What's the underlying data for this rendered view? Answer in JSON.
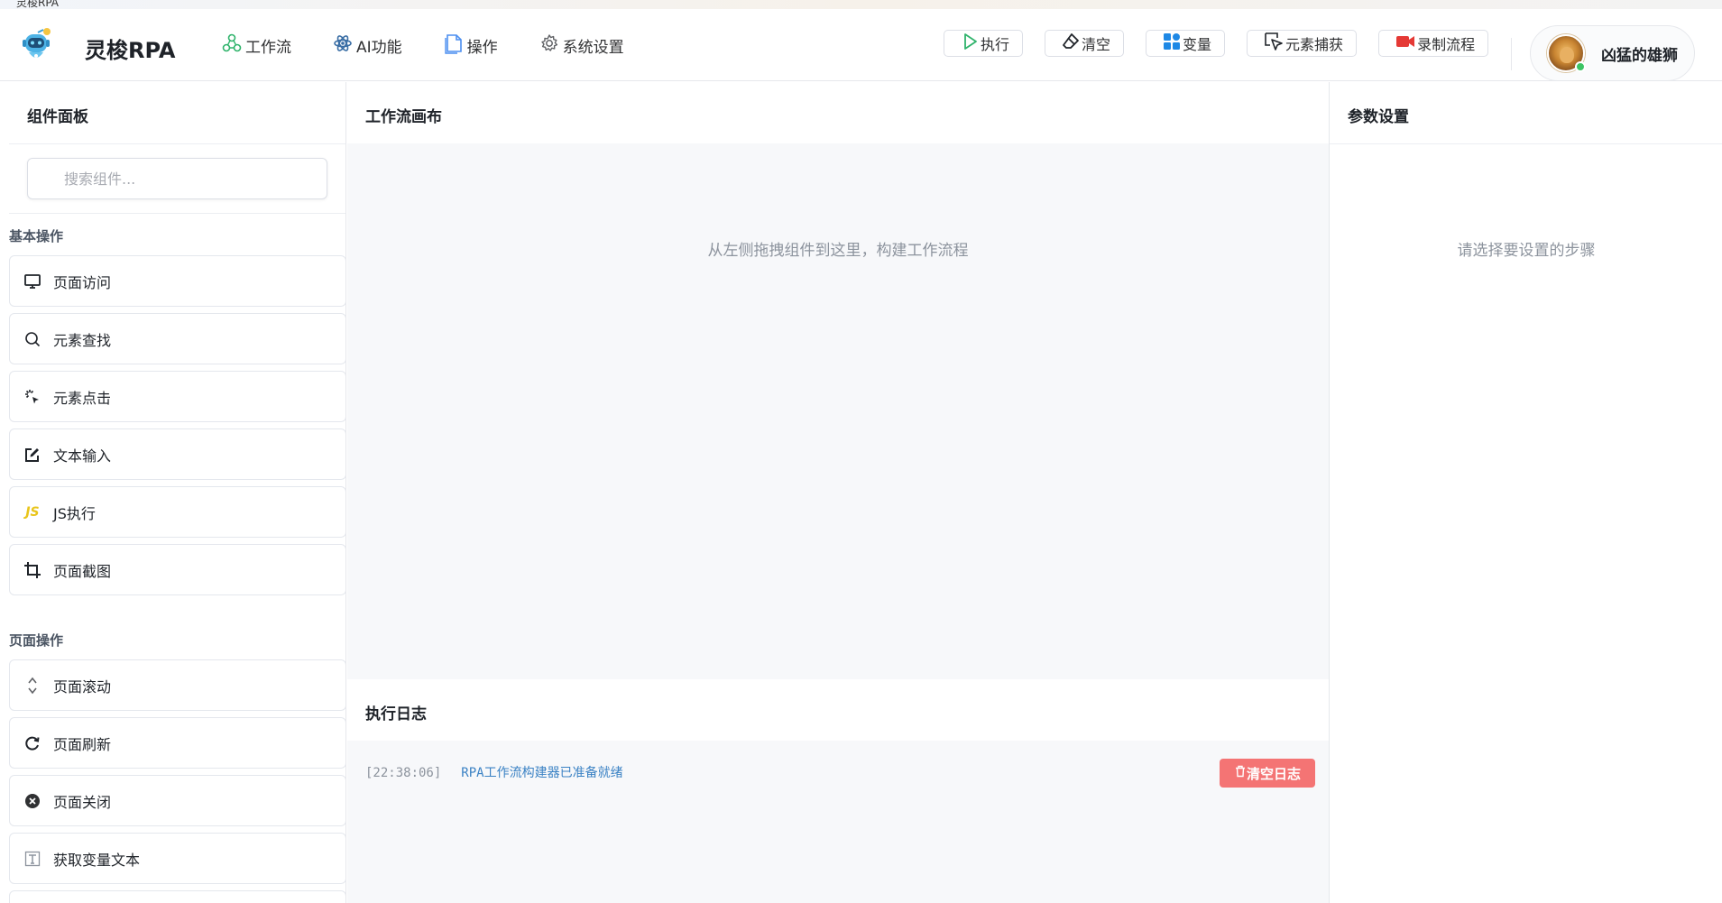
{
  "window": {
    "os_title": "灵梭RPA",
    "controls": [
      "–",
      "□",
      "×"
    ]
  },
  "header": {
    "app_title": "灵梭RPA",
    "logo_icon": "robot-logo-icon",
    "nav": [
      {
        "label": "工作流",
        "icon": "workflow-icon",
        "color": "#2fb36b"
      },
      {
        "label": "AI功能",
        "icon": "ai-icon",
        "color": "#3a6ea5"
      },
      {
        "label": "操作",
        "icon": "document-icon",
        "color": "#4d8ff0"
      },
      {
        "label": "系统设置",
        "icon": "gear-icon",
        "color": "#606266"
      }
    ],
    "toolbar": {
      "run": "执行",
      "clear": "清空",
      "variables": "变量",
      "capture": "元素捕获",
      "record": "录制流程"
    },
    "user": {
      "name": "凶猛的雄狮",
      "status_color": "#3cc464"
    }
  },
  "left_panel": {
    "title": "组件面板",
    "search_placeholder": "搜索组件...",
    "groups": [
      {
        "title": "基本操作",
        "items": [
          {
            "label": "页面访问",
            "icon": "monitor-icon"
          },
          {
            "label": "元素查找",
            "icon": "search-icon"
          },
          {
            "label": "元素点击",
            "icon": "click-icon"
          },
          {
            "label": "文本输入",
            "icon": "edit-icon"
          },
          {
            "label": "JS执行",
            "icon": "js-icon",
            "glyph": "JS"
          },
          {
            "label": "页面截图",
            "icon": "crop-icon"
          }
        ]
      },
      {
        "title": "页面操作",
        "items": [
          {
            "label": "页面滚动",
            "icon": "scroll-icon"
          },
          {
            "label": "页面刷新",
            "icon": "refresh-icon"
          },
          {
            "label": "页面关闭",
            "icon": "close-circle-icon"
          },
          {
            "label": "获取变量文本",
            "icon": "text-icon"
          }
        ]
      }
    ]
  },
  "canvas": {
    "title": "工作流画布",
    "hint": "从左侧拖拽组件到这里，构建工作流程"
  },
  "log": {
    "title": "执行日志",
    "entries": [
      {
        "time": "[22:38:06]",
        "message": "RPA工作流构建器已准备就绪"
      }
    ],
    "clear_button": "清空日志",
    "clear_button_color": "#f47474"
  },
  "right_panel": {
    "title": "参数设置",
    "hint": "请选择要设置的步骤"
  }
}
